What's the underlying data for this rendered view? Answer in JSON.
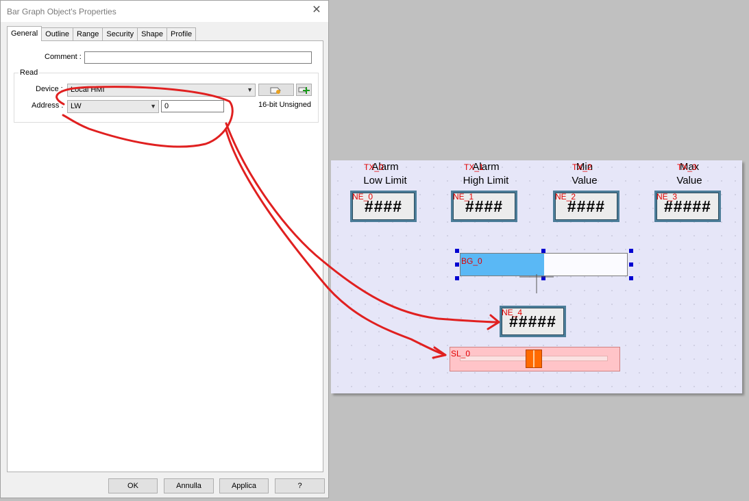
{
  "dialog": {
    "title": "Bar Graph Object's Properties",
    "close_symbol": "✕",
    "tabs": [
      {
        "label": "General",
        "active": true
      },
      {
        "label": "Outline"
      },
      {
        "label": "Range"
      },
      {
        "label": "Security"
      },
      {
        "label": "Shape"
      },
      {
        "label": "Profile"
      }
    ],
    "comment_label": "Comment :",
    "comment_value": "",
    "read_group_title": "Read",
    "device_label": "Device :",
    "device_value": "Local HMI",
    "address_label": "Address :",
    "address_type": "LW",
    "address_value": "0",
    "format": "16-bit Unsigned",
    "buttons": {
      "ok": "OK",
      "cancel": "Annulla",
      "apply": "Applica",
      "help": "?"
    }
  },
  "canvas": {
    "labels": [
      {
        "tag": "TX_0",
        "line1": "Alarm",
        "line2": "Low Limit"
      },
      {
        "tag": "TX_1",
        "line1": "Alarm",
        "line2": "High Limit"
      },
      {
        "tag": "TX_2",
        "line1": "Min",
        "line2": "Value"
      },
      {
        "tag": "TX_3",
        "line1": "Max",
        "line2": "Value"
      }
    ],
    "numeric_entries": [
      {
        "tag": "NE_0",
        "display": "####"
      },
      {
        "tag": "NE_1",
        "display": "####"
      },
      {
        "tag": "NE_2",
        "display": "####"
      },
      {
        "tag": "NE_3",
        "display": "#####"
      },
      {
        "tag": "NE_4",
        "display": "#####"
      }
    ],
    "bar_graph": {
      "tag": "BG_0",
      "fill_fraction": 0.5
    },
    "slider": {
      "tag": "SL_0",
      "position_fraction": 0.5
    }
  },
  "colors": {
    "bar_fill": "#5ab8f5",
    "slider_bg": "#ffc4c8",
    "slider_knob": "#ff6a00",
    "annotation": "#e02020",
    "tag_text": "#e00000"
  }
}
